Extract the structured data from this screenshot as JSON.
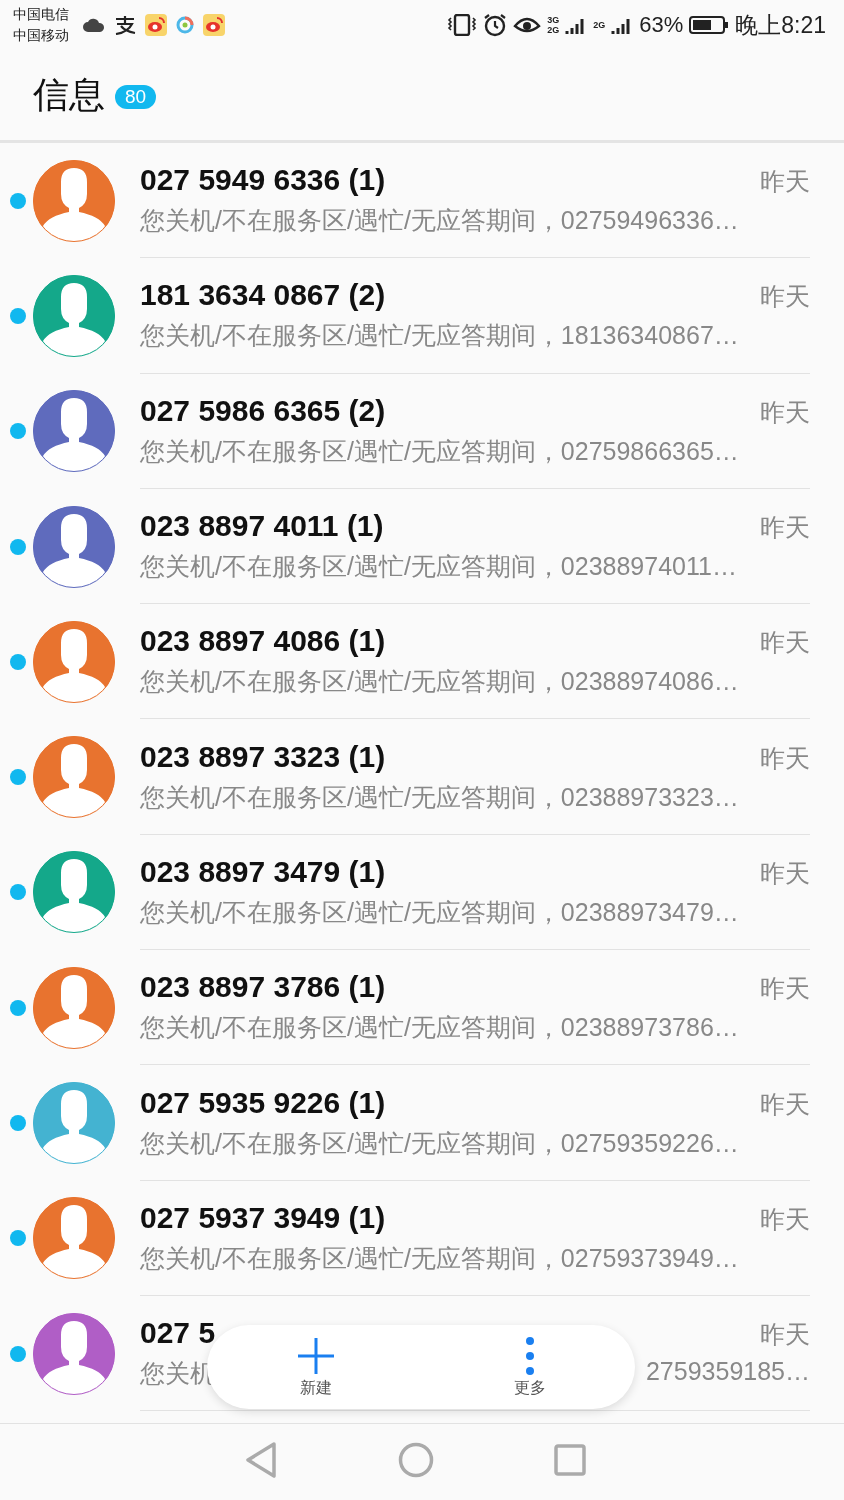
{
  "status_bar": {
    "carriers": [
      "中国电信",
      "中国移动"
    ],
    "network_1": "3G",
    "network_2": "2G",
    "network_3": "2G",
    "battery_text": "63%",
    "time": "晚上8:21"
  },
  "header": {
    "title": "信息",
    "badge": "80"
  },
  "conversations": [
    {
      "name": "027 5949 6336 (1)",
      "time": "昨天",
      "snippet": "您关机/不在服务区/遇忙/无应答期间，02759496336…",
      "unread": true,
      "color": "#e8732f"
    },
    {
      "name": "181 3634 0867 (2)",
      "time": "昨天",
      "snippet": "您关机/不在服务区/遇忙/无应答期间，18136340867…",
      "unread": true,
      "color": "#14a88a"
    },
    {
      "name": "027 5986 6365 (2)",
      "time": "昨天",
      "snippet": "您关机/不在服务区/遇忙/无应答期间，02759866365…",
      "unread": true,
      "color": "#5f6bbd"
    },
    {
      "name": "023 8897 4011 (1)",
      "time": "昨天",
      "snippet": "您关机/不在服务区/遇忙/无应答期间，02388974011…",
      "unread": true,
      "color": "#5f6bbd"
    },
    {
      "name": "023 8897 4086 (1)",
      "time": "昨天",
      "snippet": "您关机/不在服务区/遇忙/无应答期间，02388974086…",
      "unread": true,
      "color": "#e8732f"
    },
    {
      "name": "023 8897 3323 (1)",
      "time": "昨天",
      "snippet": "您关机/不在服务区/遇忙/无应答期间，02388973323…",
      "unread": true,
      "color": "#e8732f"
    },
    {
      "name": "023 8897 3479 (1)",
      "time": "昨天",
      "snippet": "您关机/不在服务区/遇忙/无应答期间，02388973479…",
      "unread": true,
      "color": "#14a88a"
    },
    {
      "name": "023 8897 3786 (1)",
      "time": "昨天",
      "snippet": "您关机/不在服务区/遇忙/无应答期间，02388973786…",
      "unread": true,
      "color": "#e8732f"
    },
    {
      "name": "027 5935 9226 (1)",
      "time": "昨天",
      "snippet": "您关机/不在服务区/遇忙/无应答期间，02759359226…",
      "unread": true,
      "color": "#44b3d1"
    },
    {
      "name": "027 5937 3949 (1)",
      "time": "昨天",
      "snippet": "您关机/不在服务区/遇忙/无应答期间，02759373949…",
      "unread": true,
      "color": "#e8732f"
    },
    {
      "name": "027 5",
      "time": "昨天",
      "snippet": "您关机",
      "snippet_tail": "2759359185…",
      "unread": true,
      "color": "#b05ec6"
    }
  ],
  "action_bar": {
    "buttons": [
      {
        "label": "新建",
        "kind": "add"
      },
      {
        "label": "更多",
        "kind": "more"
      }
    ]
  }
}
